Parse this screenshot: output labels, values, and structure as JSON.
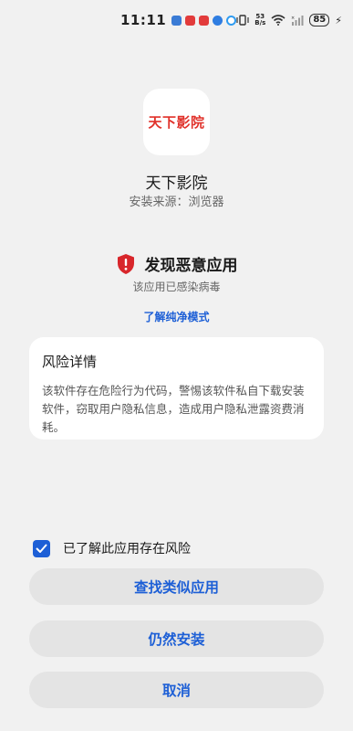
{
  "status_bar": {
    "time": "11:11",
    "net_speed_value": "53",
    "net_speed_unit": "B/s",
    "battery": "85",
    "notification_icons": [
      "app-notif-icon",
      "red-app-icon",
      "red-app-icon",
      "blue-app-icon",
      "blue-app-icon"
    ],
    "system_icons": [
      "vibrate-icon",
      "wifi-icon",
      "signal-icon",
      "battery-icon",
      "charging-icon"
    ]
  },
  "app": {
    "icon_text": "天下影院",
    "name": "天下影院",
    "source": "安装来源：浏览器"
  },
  "warning": {
    "title": "发现恶意应用",
    "subtitle": "该应用已感染病毒",
    "link": "了解纯净模式",
    "icon": "shield-alert-icon"
  },
  "risk_card": {
    "title": "风险详情",
    "body": "该软件存在危险行为代码，警惕该软件私自下载安装软件，窃取用户隐私信息，造成用户隐私泄露资费消耗。"
  },
  "acknowledge": {
    "label": "已了解此应用存在风险",
    "checked": true
  },
  "buttons": {
    "find_similar": "查找类似应用",
    "install_anyway": "仍然安装",
    "cancel": "取消"
  },
  "colors": {
    "accent": "#1d5fd6",
    "danger": "#d8262b",
    "background": "#f1f1f1",
    "button_bg": "#e4e4e4"
  }
}
